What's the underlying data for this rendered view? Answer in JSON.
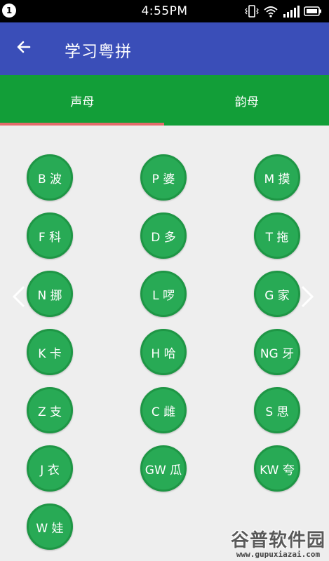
{
  "status_bar": {
    "notification_badge": "1",
    "time": "4:55PM",
    "icons": [
      "vibrate-icon",
      "wifi-icon",
      "signal-icon",
      "battery-icon"
    ]
  },
  "app_bar": {
    "back_icon": "back-arrow-icon",
    "title": "学习粤拼",
    "color": "#3a4eb8"
  },
  "tabs": {
    "items": [
      "声母",
      "韵母"
    ],
    "selected_index": 0,
    "color": "#129e38",
    "indicator_color": "#e46b6b"
  },
  "initials": [
    "B 波",
    "P 婆",
    "M 摸",
    "F 科",
    "D 多",
    "T 拖",
    "N 挪",
    "L 啰",
    "G 家",
    "K 卡",
    "H 哈",
    "NG 牙",
    "Z 支",
    "C 雌",
    "S 思",
    "J 衣",
    "GW 瓜",
    "KW 夸",
    "W 娃"
  ],
  "button_color": "#28aa55",
  "pager_arrows": {
    "left": "chevron-left-icon",
    "right": "chevron-right-icon"
  },
  "watermark": {
    "text": "谷普软件园",
    "url": "www.gupuxiazai.com"
  }
}
